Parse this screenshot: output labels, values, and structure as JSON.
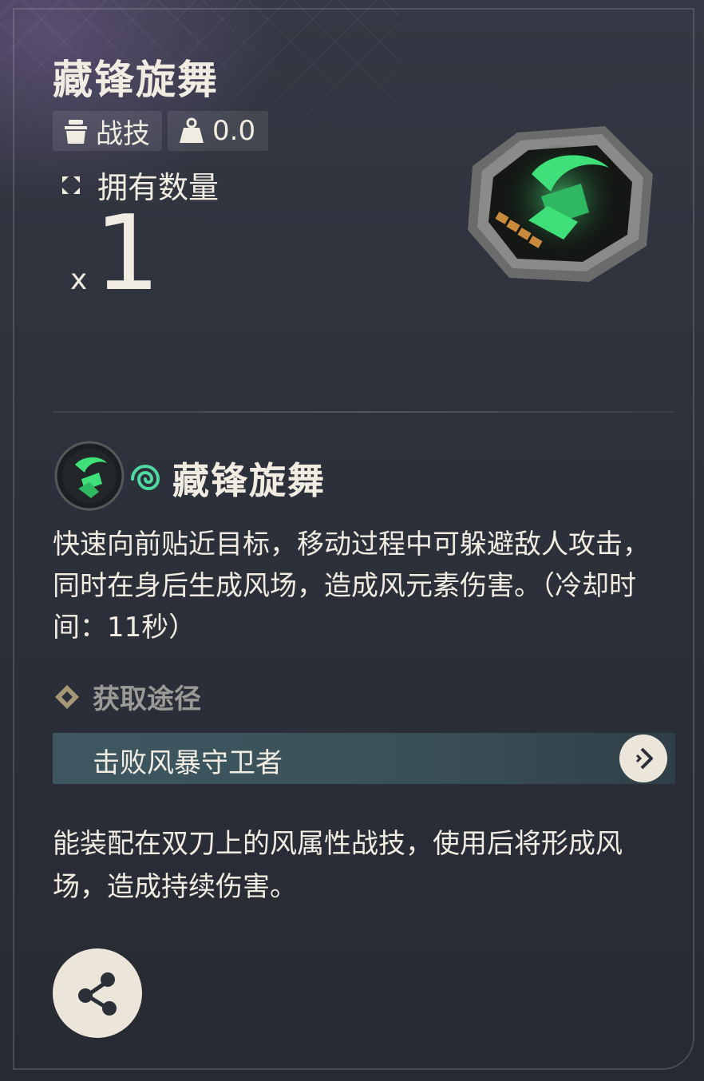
{
  "item": {
    "name": "藏锋旋舞",
    "category_label": "战技",
    "weight_value": "0.0",
    "owned_label": "拥有数量",
    "owned_prefix": "x",
    "owned_count": "1"
  },
  "skill": {
    "name": "藏锋旋舞",
    "element_icon": "wind-spiral-icon",
    "description": "快速向前贴近目标，移动过程中可躲避敌人攻击，同时在身后生成风场，造成风元素伤害。（冷却时间：11秒）"
  },
  "acquire": {
    "heading": "获取途径",
    "source": "击败风暴守卫者"
  },
  "flavor_text": "能装配在双刀上的风属性战技，使用后将形成风场，造成持续伤害。",
  "colors": {
    "text": "#f1ece1",
    "accent_green": "#3fe07a",
    "source_bar": "#3e5761",
    "button_bg": "#ece6da"
  }
}
